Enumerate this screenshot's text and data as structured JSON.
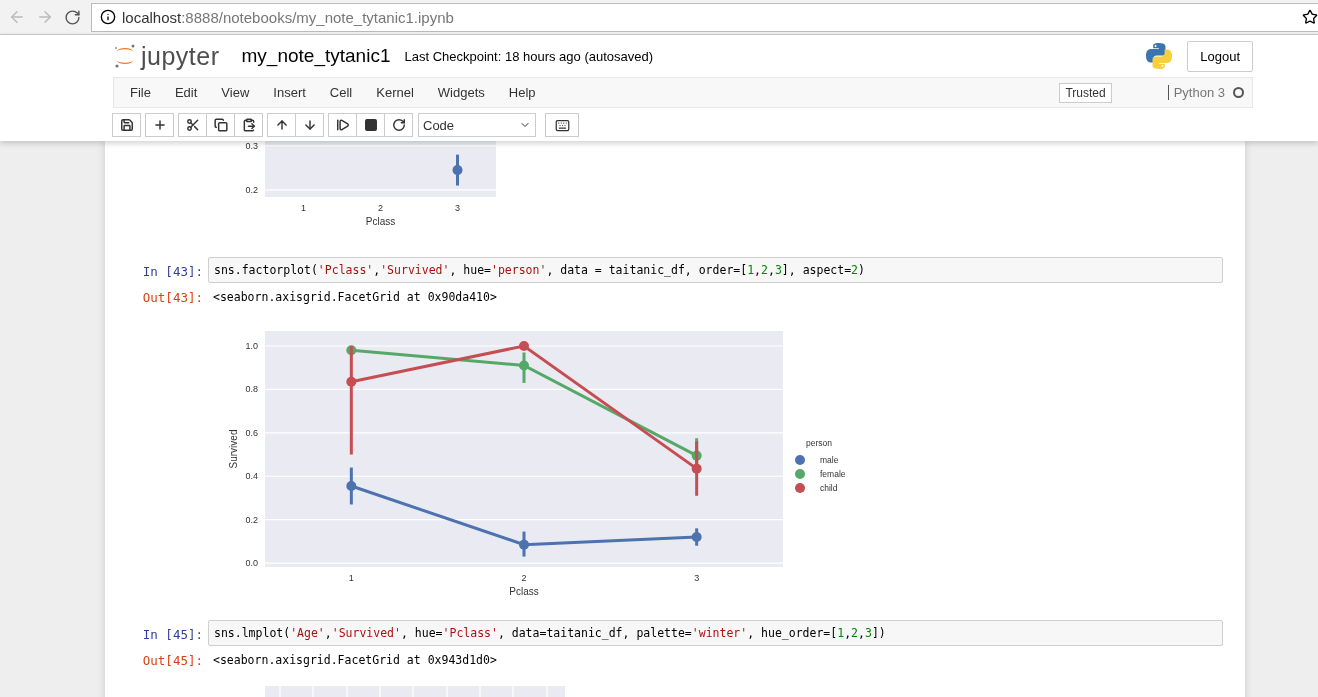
{
  "browser": {
    "address": {
      "host": "localhost",
      "path": ":8888/notebooks/my_note_tytanic1.ipynb"
    }
  },
  "header": {
    "logo_text": "jupyter",
    "notebook_name": "my_note_tytanic1",
    "checkpoint": "Last Checkpoint: 18 hours ago (autosaved)",
    "logout": "Logout"
  },
  "menu": {
    "items": [
      "File",
      "Edit",
      "View",
      "Insert",
      "Cell",
      "Kernel",
      "Widgets",
      "Help"
    ],
    "trusted": "Trusted",
    "kernel": "Python 3",
    "kernel_busy": false
  },
  "toolbar": {
    "groups": [
      [
        {
          "kind": "save"
        }
      ],
      [
        {
          "kind": "add"
        }
      ],
      [
        {
          "kind": "cut"
        },
        {
          "kind": "copy"
        },
        {
          "kind": "paste"
        }
      ],
      [
        {
          "kind": "up"
        },
        {
          "kind": "down"
        }
      ],
      [
        {
          "kind": "run"
        },
        {
          "kind": "stop"
        },
        {
          "kind": "restart"
        }
      ]
    ],
    "cell_type": "Code"
  },
  "cells": [
    {
      "kind": "plot",
      "chart_data": {
        "type": "line",
        "xlabel": "Pclass",
        "categories": [
          "1",
          "2",
          "3"
        ],
        "ylim": [
          0.184,
          0.311
        ],
        "yticks": [
          0.2,
          0.3
        ],
        "grid": true,
        "series": [
          {
            "color": "#4c72b0",
            "marker": "o",
            "values": [
              null,
              null,
              0.245
            ],
            "errors": [
              null,
              null,
              [
                0.21,
                0.28
              ]
            ]
          }
        ]
      }
    },
    {
      "kind": "input",
      "prompt": "In [43]:",
      "code": [
        {
          "kind": "plain",
          "text": "sns.factorplot("
        },
        {
          "kind": "string",
          "text": "'Pclass'"
        },
        {
          "kind": "plain",
          "text": ","
        },
        {
          "kind": "string",
          "text": "'Survived'"
        },
        {
          "kind": "plain",
          "text": ", hue="
        },
        {
          "kind": "string",
          "text": "'person'"
        },
        {
          "kind": "plain",
          "text": ", data = taitanic_df, order=["
        },
        {
          "kind": "number",
          "text": "1"
        },
        {
          "kind": "plain",
          "text": ","
        },
        {
          "kind": "number",
          "text": "2"
        },
        {
          "kind": "plain",
          "text": ","
        },
        {
          "kind": "number",
          "text": "3"
        },
        {
          "kind": "plain",
          "text": "], aspect="
        },
        {
          "kind": "number",
          "text": "2"
        },
        {
          "kind": "plain",
          "text": ")"
        }
      ]
    },
    {
      "kind": "output",
      "prompt": "Out[43]:",
      "text": "<seaborn.axisgrid.FacetGrid at 0x90da410>"
    },
    {
      "kind": "plot",
      "chart_data": {
        "type": "line",
        "xlabel": "Pclass",
        "ylabel": "Survived",
        "categories": [
          "1",
          "2",
          "3"
        ],
        "ylim": [
          -0.018,
          1.069
        ],
        "yticks": [
          {
            "value": 0,
            "label": "0.0"
          },
          0.2,
          0.4,
          0.6,
          0.8,
          {
            "value": 1,
            "label": "1.0"
          }
        ],
        "grid": true,
        "legend": {
          "title": "person"
        },
        "series": [
          {
            "name": "male",
            "color": "#4c72b0",
            "marker": "o",
            "values": [
              0.355,
              0.085,
              0.12
            ],
            "errors": [
              [
                0.27,
                0.44
              ],
              [
                0.03,
                0.145
              ],
              [
                0.08,
                0.16
              ]
            ]
          },
          {
            "name": "female",
            "color": "#55a868",
            "marker": "o",
            "values": [
              0.98,
              0.91,
              0.495
            ],
            "errors": [
              [
                0.96,
                1.0
              ],
              [
                0.83,
                0.97
              ],
              [
                0.41,
                0.575
              ]
            ]
          },
          {
            "name": "child",
            "color": "#c44e52",
            "marker": "o",
            "values": [
              0.835,
              1.0,
              0.435
            ],
            "errors": [
              [
                0.5,
                1.0
              ],
              [
                1.0,
                1.0
              ],
              [
                0.31,
                0.56
              ]
            ]
          }
        ]
      }
    },
    {
      "kind": "input",
      "prompt": "In [45]:",
      "code": [
        {
          "kind": "plain",
          "text": "sns.lmplot("
        },
        {
          "kind": "string",
          "text": "'Age'"
        },
        {
          "kind": "plain",
          "text": ","
        },
        {
          "kind": "string",
          "text": "'Survived'"
        },
        {
          "kind": "plain",
          "text": ", hue="
        },
        {
          "kind": "string",
          "text": "'Pclass'"
        },
        {
          "kind": "plain",
          "text": ", data=taitanic_df, palette="
        },
        {
          "kind": "string",
          "text": "'winter'"
        },
        {
          "kind": "plain",
          "text": ", hue_order=["
        },
        {
          "kind": "number",
          "text": "1"
        },
        {
          "kind": "plain",
          "text": ","
        },
        {
          "kind": "number",
          "text": "2"
        },
        {
          "kind": "plain",
          "text": ","
        },
        {
          "kind": "number",
          "text": "3"
        },
        {
          "kind": "plain",
          "text": "])"
        }
      ]
    },
    {
      "kind": "output",
      "prompt": "Out[45]:",
      "text": "<seaborn.axisgrid.FacetGrid at 0x943d1d0>"
    },
    {
      "kind": "plot-stub"
    }
  ]
}
